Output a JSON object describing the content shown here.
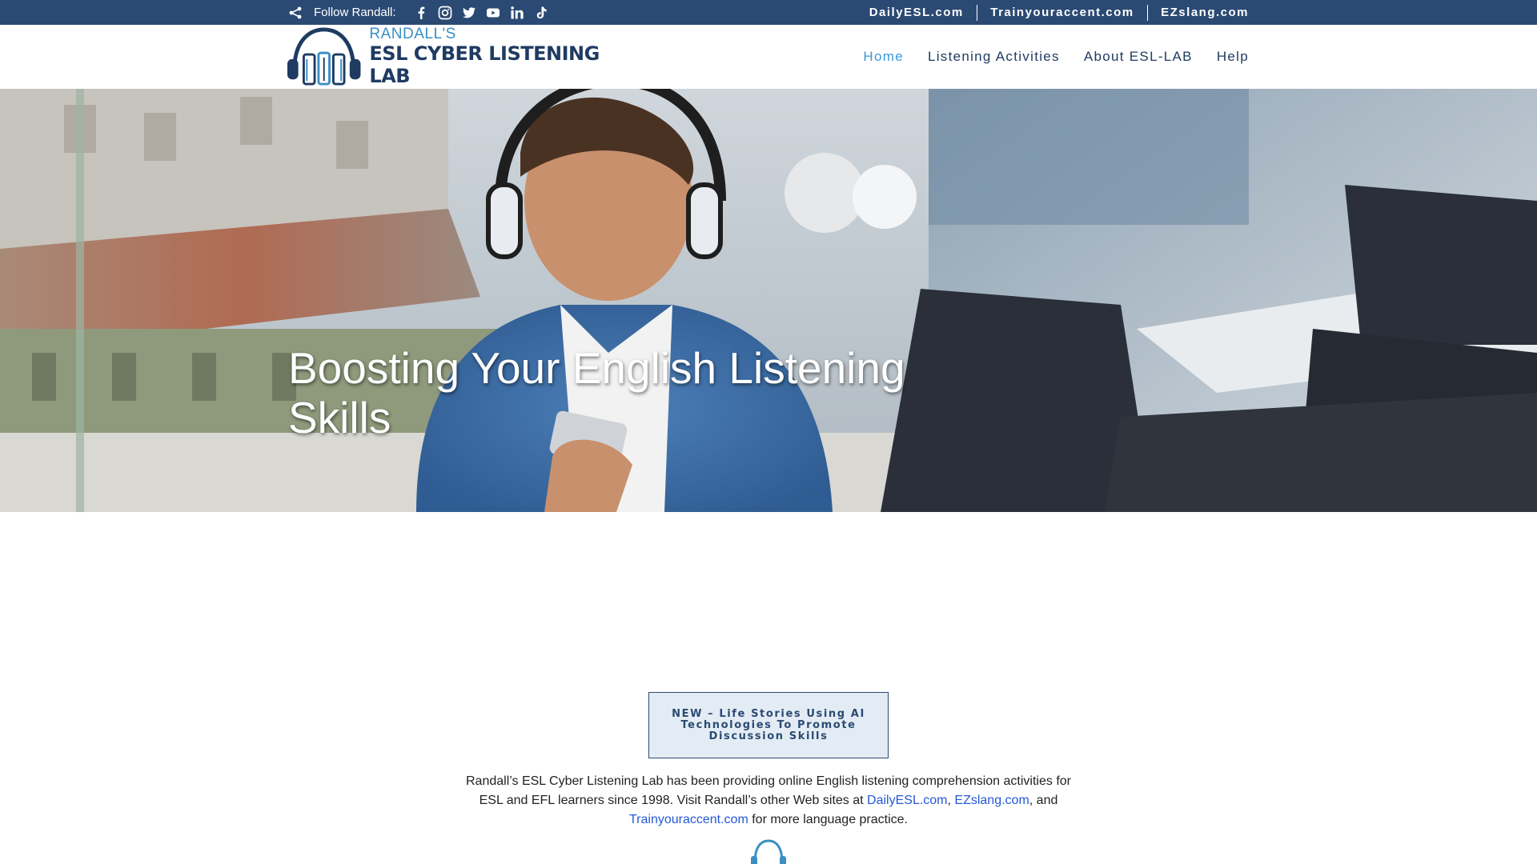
{
  "topbar": {
    "follow_label": "Follow Randall:",
    "social_icons": [
      "facebook-icon",
      "instagram-icon",
      "twitter-icon",
      "youtube-icon",
      "linkedin-icon",
      "tiktok-icon"
    ],
    "sites": [
      "DailyESL.com",
      "Trainyouraccent.com",
      "EZslang.com"
    ],
    "background": "#2b4a73"
  },
  "header": {
    "logo_small": "RANDALL'S",
    "logo_big": "ESL CYBER LISTENING LAB",
    "nav": [
      {
        "label": "Home",
        "active": true
      },
      {
        "label": "Listening Activities",
        "active": false
      },
      {
        "label": "About ESL-LAB",
        "active": false
      },
      {
        "label": "Help",
        "active": false
      }
    ],
    "active_color": "#3c9ad6",
    "text_color": "#1f3b62"
  },
  "hero": {
    "title": "Boosting Your English Listening Skills"
  },
  "cta": {
    "label": "NEW – Life Stories Using AI Technologies To Promote Discussion Skills"
  },
  "intro": {
    "text_1": "Randall’s ESL Cyber Listening Lab has been providing online English listening comprehension activities for ESL and EFL learners since 1998. Visit Randall’s other Web sites at ",
    "link_1": "DailyESL.com",
    "text_2": ", ",
    "link_2": "EZslang.com",
    "text_3": ", and ",
    "link_3": "Trainyouraccent.com",
    "text_4": " for more language practice.",
    "link_color": "#2459d6"
  }
}
